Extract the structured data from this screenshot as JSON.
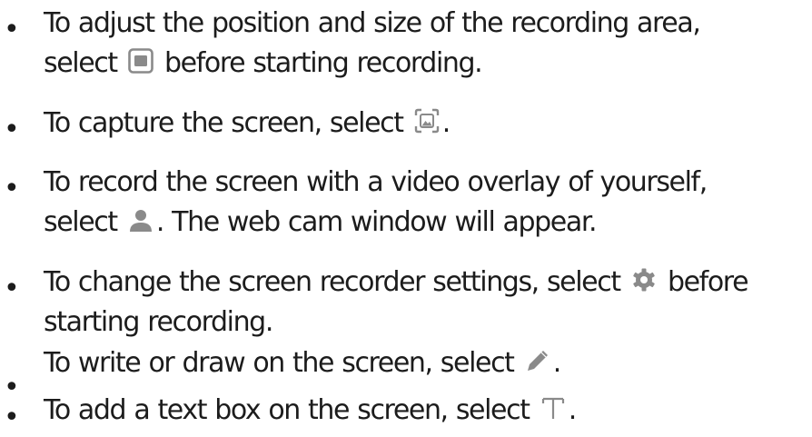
{
  "colors": {
    "text": "#1c1c1c",
    "icon": "#8a8a8a"
  },
  "bullet_glyph": "•",
  "items": [
    {
      "line1": "To adjust the position and size of the recording area,",
      "line2_before": "select",
      "icon": "square-icon",
      "line2_after": "before starting recording."
    },
    {
      "line1_before": "To capture the screen, select",
      "icon": "screenshot-icon",
      "line1_after": "."
    },
    {
      "line1": "To record the screen with a video overlay of yourself,",
      "line2_before": "select",
      "icon": "person-icon",
      "line2_after": ". The web cam window will appear."
    },
    {
      "line1_before": "To change the screen recorder settings, select",
      "icon": "gear-icon",
      "line1_after": "before",
      "line2": "starting recording."
    },
    {
      "line1_before": "To write or draw on the screen, select",
      "icon": "pencil-icon",
      "line1_after": "."
    },
    {
      "line1_before": "To add a text box on the screen, select",
      "icon": "text-tool-icon",
      "line1_after": "."
    }
  ]
}
